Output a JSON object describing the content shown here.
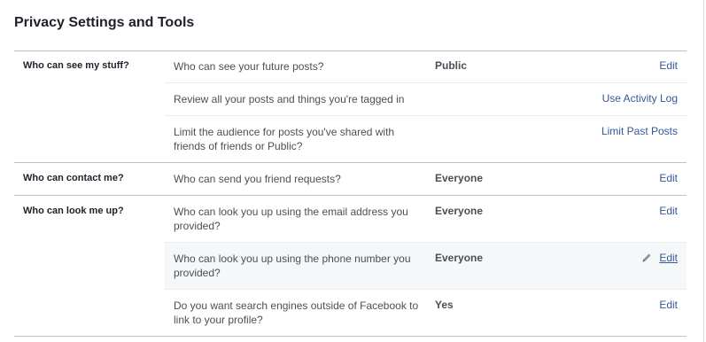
{
  "page": {
    "title": "Privacy Settings and Tools"
  },
  "sections": [
    {
      "label": "Who can see my stuff?",
      "rows": [
        {
          "text": "Who can see your future posts?",
          "value": "Public",
          "action": "Edit"
        },
        {
          "text": "Review all your posts and things you're tagged in",
          "value": "",
          "action": "Use Activity Log"
        },
        {
          "text": "Limit the audience for posts you've shared with friends of friends or Public?",
          "value": "",
          "action": "Limit Past Posts"
        }
      ]
    },
    {
      "label": "Who can contact me?",
      "rows": [
        {
          "text": "Who can send you friend requests?",
          "value": "Everyone",
          "action": "Edit"
        }
      ]
    },
    {
      "label": "Who can look me up?",
      "rows": [
        {
          "text": "Who can look you up using the email address you provided?",
          "value": "Everyone",
          "action": "Edit"
        },
        {
          "text": "Who can look you up using the phone number you provided?",
          "value": "Everyone",
          "action": "Edit",
          "hovered": true,
          "icon": "pencil-icon"
        },
        {
          "text": "Do you want search engines outside of Facebook to link to your profile?",
          "value": "Yes",
          "action": "Edit"
        }
      ]
    }
  ],
  "colors": {
    "link": "#365899",
    "label": "#1d2129",
    "muted_text": "#4b4f56",
    "divider": "#bec3c9",
    "subdivider": "#e9ebee",
    "hover_row": "#f6f7f9"
  }
}
